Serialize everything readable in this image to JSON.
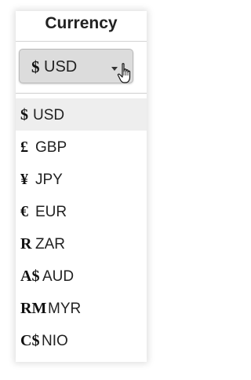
{
  "title": "Currency",
  "select": {
    "symbol": "$",
    "code": "USD"
  },
  "options": [
    {
      "symbol": "$",
      "code": "USD"
    },
    {
      "symbol": "£",
      "code": "GBP"
    },
    {
      "symbol": "¥",
      "code": "JPY"
    },
    {
      "symbol": "€",
      "code": "EUR"
    },
    {
      "symbol": "R",
      "code": "ZAR"
    },
    {
      "symbol": "A$",
      "code": "AUD"
    },
    {
      "symbol": "RM",
      "code": "MYR"
    },
    {
      "symbol": "C$",
      "code": "NIO"
    }
  ],
  "icons": {
    "caret": "chevron-down-icon",
    "cursor": "hand-pointer-icon"
  },
  "colors": {
    "select_bg": "#dcdcdc",
    "highlight_bg": "#eeeeee",
    "text": "#222222"
  }
}
